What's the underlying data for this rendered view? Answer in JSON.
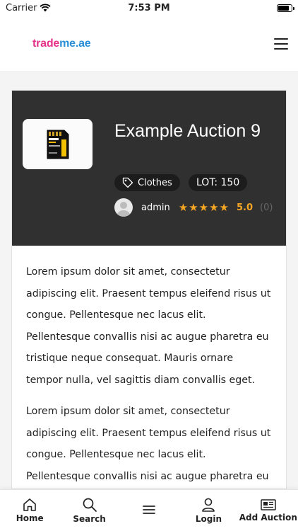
{
  "status_bar": {
    "carrier": "Carrier",
    "time": "7:53 PM",
    "battery_level": 0.9
  },
  "header": {
    "logo_part1": "trade",
    "logo_part2": "me.ae",
    "brand_pink": "#e6338a",
    "brand_blue": "#2a8fd6"
  },
  "auction": {
    "title": "Example Auction 9",
    "category": "Clothes",
    "lot": "LOT: 150",
    "seller": "admin",
    "stars": 5,
    "rating": "5.0",
    "review_count": "(0)",
    "description": [
      "Lorem ipsum dolor sit amet, consectetur adipiscing elit. Praesent tempus eleifend risus ut congue. Pellentesque nec lacus elit. Pellentesque convallis nisi ac augue pharetra eu tristique neque consequat. Mauris ornare tempor nulla, vel sagittis diam convallis eget.",
      "Lorem ipsum dolor sit amet, consectetur adipiscing elit. Praesent tempus eleifend risus ut congue. Pellentesque nec lacus elit. Pellentesque convallis nisi ac augue pharetra eu tristique"
    ],
    "thumbnail_icon": "sd-card-icon",
    "accent_star": "#f5a623"
  },
  "bottom_nav": [
    {
      "label": "Home",
      "icon": "home-icon"
    },
    {
      "label": "Search",
      "icon": "search-icon"
    },
    {
      "label": "",
      "icon": "menu-icon"
    },
    {
      "label": "Login",
      "icon": "user-icon"
    },
    {
      "label": "Add Auction",
      "icon": "newspaper-icon"
    }
  ]
}
